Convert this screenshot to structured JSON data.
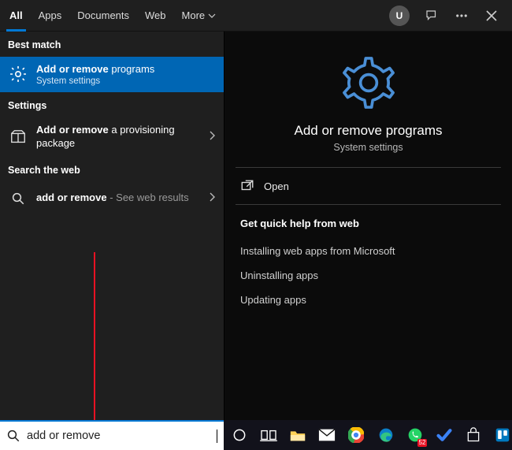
{
  "tabs": {
    "all": "All",
    "apps": "Apps",
    "documents": "Documents",
    "web": "Web",
    "more": "More"
  },
  "avatar_initial": "U",
  "left": {
    "best_match_header": "Best match",
    "best_match": {
      "title_bold": "Add or remove",
      "title_rest": " programs",
      "subtitle": "System settings"
    },
    "settings_header": "Settings",
    "settings_item": {
      "title_bold": "Add or remove",
      "title_rest": " a provisioning package"
    },
    "web_header": "Search the web",
    "web_item": {
      "title_bold": "add or remove",
      "hint": " - See web results"
    }
  },
  "detail": {
    "title": "Add or remove programs",
    "subtitle": "System settings",
    "open": "Open",
    "help_heading": "Get quick help from web",
    "help_links": {
      "l0": "Installing web apps from Microsoft",
      "l1": "Uninstalling apps",
      "l2": "Updating apps"
    }
  },
  "search": {
    "value": "add or remove"
  },
  "taskbar": {
    "badge": "52"
  }
}
